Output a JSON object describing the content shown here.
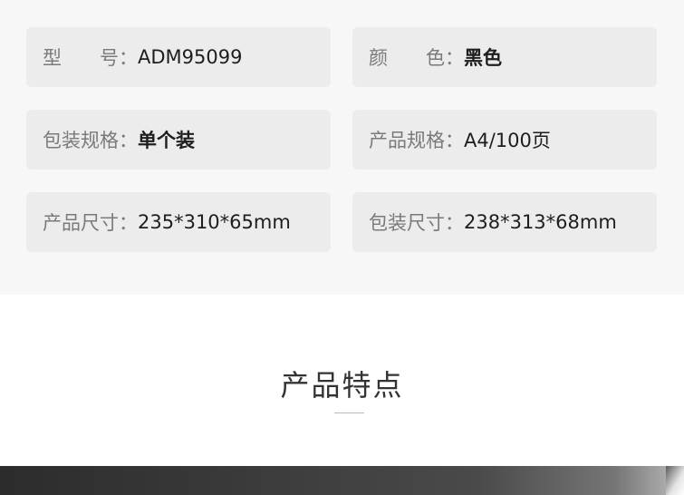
{
  "specs": [
    {
      "key": "型　　号：",
      "value": "ADM95099"
    },
    {
      "key": "颜　　色：",
      "value": "黑色"
    },
    {
      "key": "包装规格：",
      "value": "单个装"
    },
    {
      "key": "产品规格：",
      "value": "A4/100页"
    },
    {
      "key": "产品尺寸：",
      "value": "235*310*65mm"
    },
    {
      "key": "包装尺寸：",
      "value": "238*313*68mm"
    }
  ],
  "section": {
    "title": "产品特点"
  }
}
